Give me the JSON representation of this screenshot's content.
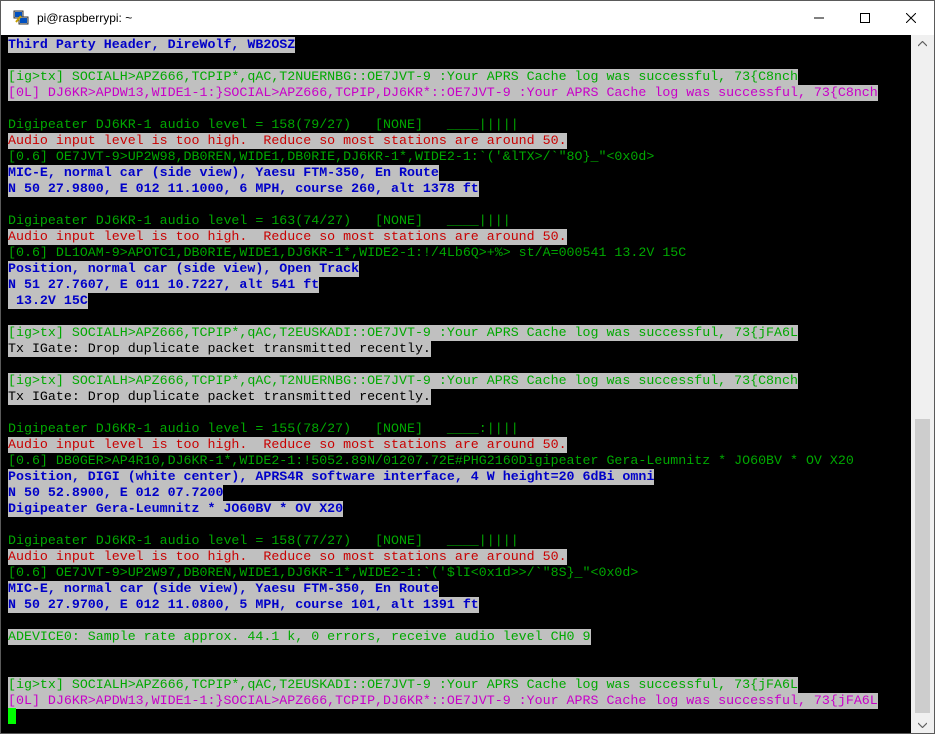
{
  "window": {
    "title": "pi@raspberrypi: ~"
  },
  "colors": {
    "blue": "#0000c8",
    "green": "#00a800",
    "magenta": "#c800c8",
    "red": "#c80000",
    "highlight": "#c0c0c0",
    "cursor": "#00ff00"
  },
  "terminal": {
    "lines": [
      "Third Party Header, DireWolf, WB2OSZ",
      "",
      "[ig>tx] SOCIALH>APZ666,TCPIP*,qAC,T2NUERNBG::OE7JVT-9 :Your APRS Cache log was successful, 73{C8nch",
      "[0L] DJ6KR>APDW13,WIDE1-1:}SOCIAL>APZ666,TCPIP,DJ6KR*::OE7JVT-9 :Your APRS Cache log was successful, 73{C8nch",
      "",
      "Digipeater DJ6KR-1 audio level = 158(79/27)   [NONE]   ____|||||",
      "Audio input level is too high.  Reduce so most stations are around 50.",
      "[0.6] OE7JVT-9>UP2W98,DB0REN,WIDE1,DB0RIE,DJ6KR-1*,WIDE2-1:`('&lTX>/`\"8O}_\"<0x0d>",
      "MIC-E, normal car (side view), Yaesu FTM-350, En Route",
      "N 50 27.9800, E 012 11.1000, 6 MPH, course 260, alt 1378 ft",
      "",
      "Digipeater DJ6KR-1 audio level = 163(74/27)   [NONE]   ____||||",
      "Audio input level is too high.  Reduce so most stations are around 50.",
      "[0.6] DL1OAM-9>APOTC1,DB0RIE,WIDE1,DJ6KR-1*,WIDE2-1:!/4Lb6Q>+%> st/A=000541 13.2V 15C",
      "Position, normal car (side view), Open Track",
      "N 51 27.7607, E 011 10.7227, alt 541 ft",
      " 13.2V 15C",
      "",
      "[ig>tx] SOCIALH>APZ666,TCPIP*,qAC,T2EUSKADI::OE7JVT-9 :Your APRS Cache log was successful, 73{jFA6L",
      "Tx IGate: Drop duplicate packet transmitted recently.",
      "",
      "[ig>tx] SOCIALH>APZ666,TCPIP*,qAC,T2NUERNBG::OE7JVT-9 :Your APRS Cache log was successful, 73{C8nch",
      "Tx IGate: Drop duplicate packet transmitted recently.",
      "",
      "Digipeater DJ6KR-1 audio level = 155(78/27)   [NONE]   ____:||||",
      "Audio input level is too high.  Reduce so most stations are around 50.",
      "[0.6] DB0GER>AP4R10,DJ6KR-1*,WIDE2-1:!5052.89N/01207.72E#PHG2160Digipeater Gera-Leumnitz * JO60BV * OV X20",
      "Position, DIGI (white center), APRS4R software interface, 4 W height=20 6dBi omni",
      "N 50 52.8900, E 012 07.7200",
      "Digipeater Gera-Leumnitz * JO60BV * OV X20",
      "",
      "Digipeater DJ6KR-1 audio level = 158(77/27)   [NONE]   ____|||||",
      "Audio input level is too high.  Reduce so most stations are around 50.",
      "[0.6] OE7JVT-9>UP2W97,DB0REN,WIDE1,DJ6KR-1*,WIDE2-1:`('$lI<0x1d>>/`\"8S}_\"<0x0d>",
      "MIC-E, normal car (side view), Yaesu FTM-350, En Route",
      "N 50 27.9700, E 012 11.0800, 5 MPH, course 101, alt 1391 ft",
      "",
      "ADEVICE0: Sample rate approx. 44.1 k, 0 errors, receive audio level CH0 9",
      "",
      "",
      "[ig>tx] SOCIALH>APZ666,TCPIP*,qAC,T2EUSKADI::OE7JVT-9 :Your APRS Cache log was successful, 73{jFA6L",
      "[0L] DJ6KR>APDW13,WIDE1-1:}SOCIAL>APZ666,TCPIP,DJ6KR*::OE7JVT-9 :Your APRS Cache log was successful, 73{jFA6L"
    ]
  },
  "icons": {
    "app": "putty-icon",
    "minimize": "minimize-icon",
    "maximize": "maximize-icon",
    "close": "close-icon",
    "scroll_up": "scroll-up-arrow-icon",
    "scroll_down": "scroll-down-arrow-icon"
  }
}
